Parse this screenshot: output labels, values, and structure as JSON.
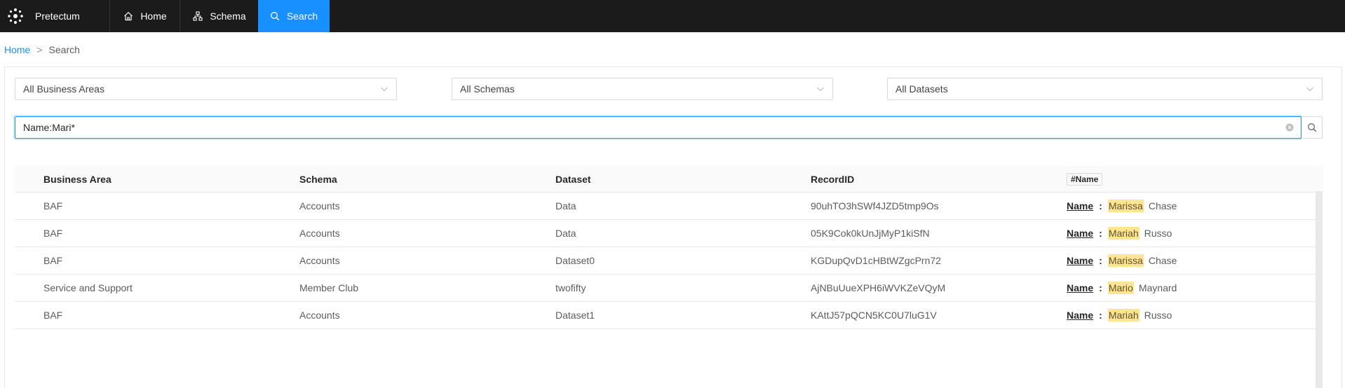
{
  "app": {
    "name": "Pretectum"
  },
  "nav": {
    "home": {
      "label": "Home",
      "icon": "home-icon"
    },
    "schema": {
      "label": "Schema",
      "icon": "schema-icon"
    },
    "search": {
      "label": "Search",
      "icon": "search-icon",
      "active": true
    }
  },
  "colors": {
    "nav_bg": "#1b1b1c",
    "accent": "#1890ff",
    "highlight": "#ffe58f"
  },
  "breadcrumb": {
    "home": "Home",
    "separator": ">",
    "current": "Search"
  },
  "filters": {
    "business_area": "All Business Areas",
    "schema": "All Schemas",
    "dataset": "All Datasets"
  },
  "search": {
    "value": "Name:Mari*"
  },
  "table": {
    "columns": [
      "Business Area",
      "Schema",
      "Dataset",
      "RecordID",
      "#Name"
    ],
    "rows": [
      {
        "business_area": "BAF",
        "schema": "Accounts",
        "dataset": "Data",
        "record_id": "90uhTO3hSWf4JZD5tmp9Os",
        "name_key": "Name",
        "name_colon": ":",
        "name_match": "Marissa",
        "name_rest": "Chase"
      },
      {
        "business_area": "BAF",
        "schema": "Accounts",
        "dataset": "Data",
        "record_id": "05K9Cok0kUnJjMyP1kiSfN",
        "name_key": "Name",
        "name_colon": ":",
        "name_match": "Mariah",
        "name_rest": "Russo"
      },
      {
        "business_area": "BAF",
        "schema": "Accounts",
        "dataset": "Dataset0",
        "record_id": "KGDupQvD1cHBtWZgcPrn72",
        "name_key": "Name",
        "name_colon": ":",
        "name_match": "Marissa",
        "name_rest": "Chase"
      },
      {
        "business_area": "Service and Support",
        "schema": "Member Club",
        "dataset": "twofifty",
        "record_id": "AjNBuUueXPH6iWVKZeVQyM",
        "name_key": "Name",
        "name_colon": ":",
        "name_match": "Mario",
        "name_rest": "Maynard"
      },
      {
        "business_area": "BAF",
        "schema": "Accounts",
        "dataset": "Dataset1",
        "record_id": "KAttJ57pQCN5KC0U7luG1V",
        "name_key": "Name",
        "name_colon": ":",
        "name_match": "Mariah",
        "name_rest": "Russo"
      }
    ]
  }
}
